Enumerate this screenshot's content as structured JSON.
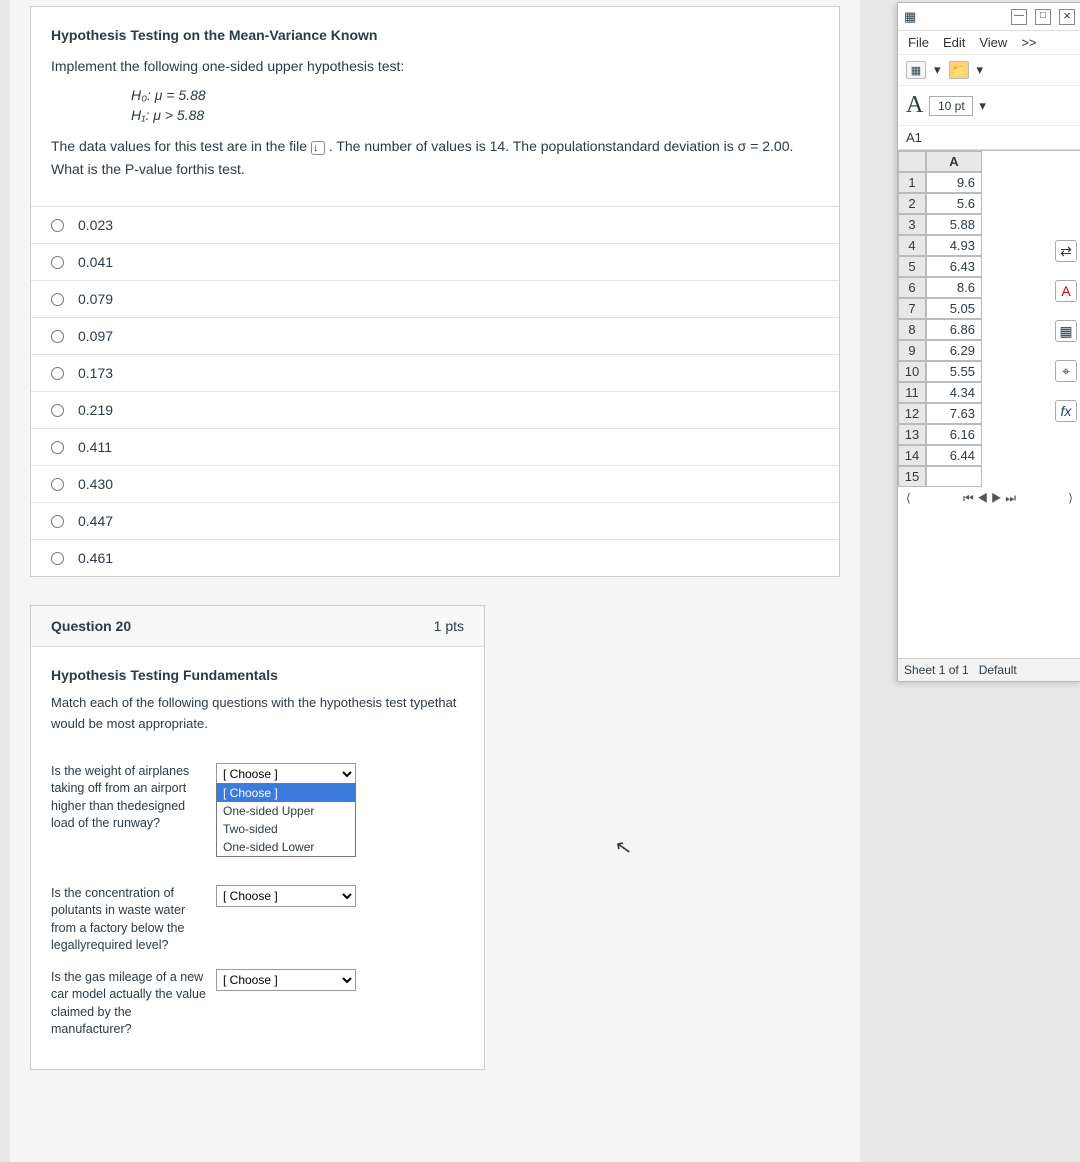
{
  "quiz": {
    "q19": {
      "title": "Hypothesis Testing on the Mean-Variance Known",
      "intro": "Implement the following one-sided upper hypothesis test:",
      "h0": "H₀: μ = 5.88",
      "h1": "H₁: μ > 5.88",
      "body_a": "The data values for this test are in the file ",
      "body_b": ". The number of values is 14. The populationstandard deviation is σ = 2.00. What is the P-value forthis test.",
      "answers": [
        "0.023",
        "0.041",
        "0.079",
        "0.097",
        "0.173",
        "0.219",
        "0.411",
        "0.430",
        "0.447",
        "0.461"
      ]
    },
    "q20": {
      "header_num": "Question 20",
      "header_pts": "1 pts",
      "subtitle": "Hypothesis Testing Fundamentals",
      "prompt": "Match each of the following questions with the hypothesis test typethat would be most appropriate.",
      "matches": [
        {
          "q": "Is the weight of airplanes taking off from an airport higher than thedesigned load of the runway?",
          "sel": "[ Choose ]"
        },
        {
          "q": "Is the concentration of polutants in waste water from a factory below the legallyrequired level?",
          "sel": "[ Choose ]"
        },
        {
          "q": "Is the gas mileage of a new car model actually the value claimed by the manufacturer?",
          "sel": "[ Choose ]"
        }
      ],
      "dropdown_options": [
        "[ Choose ]",
        "One-sided Upper",
        "Two-sided",
        "One-sided Lower"
      ]
    }
  },
  "calc": {
    "menus": [
      "File",
      "Edit",
      "View",
      ">>"
    ],
    "font_size": "10 pt",
    "cell_ref": "A1",
    "col_header": "A",
    "rows": [
      {
        "n": "1",
        "v": "9.6"
      },
      {
        "n": "2",
        "v": "5.6"
      },
      {
        "n": "3",
        "v": "5.88"
      },
      {
        "n": "4",
        "v": "4.93"
      },
      {
        "n": "5",
        "v": "6.43"
      },
      {
        "n": "6",
        "v": "8.6"
      },
      {
        "n": "7",
        "v": "5.05"
      },
      {
        "n": "8",
        "v": "6.86"
      },
      {
        "n": "9",
        "v": "6.29"
      },
      {
        "n": "10",
        "v": "5.55"
      },
      {
        "n": "11",
        "v": "4.34"
      },
      {
        "n": "12",
        "v": "7.63"
      },
      {
        "n": "13",
        "v": "6.16"
      },
      {
        "n": "14",
        "v": "6.44"
      },
      {
        "n": "15",
        "v": ""
      }
    ],
    "status_sheet": "Sheet 1 of 1",
    "status_style": "Default"
  },
  "side_icons": {
    "arrows": "⇄",
    "font_color": "A",
    "image": "▦",
    "compass": "⌖",
    "fx": "fx"
  }
}
